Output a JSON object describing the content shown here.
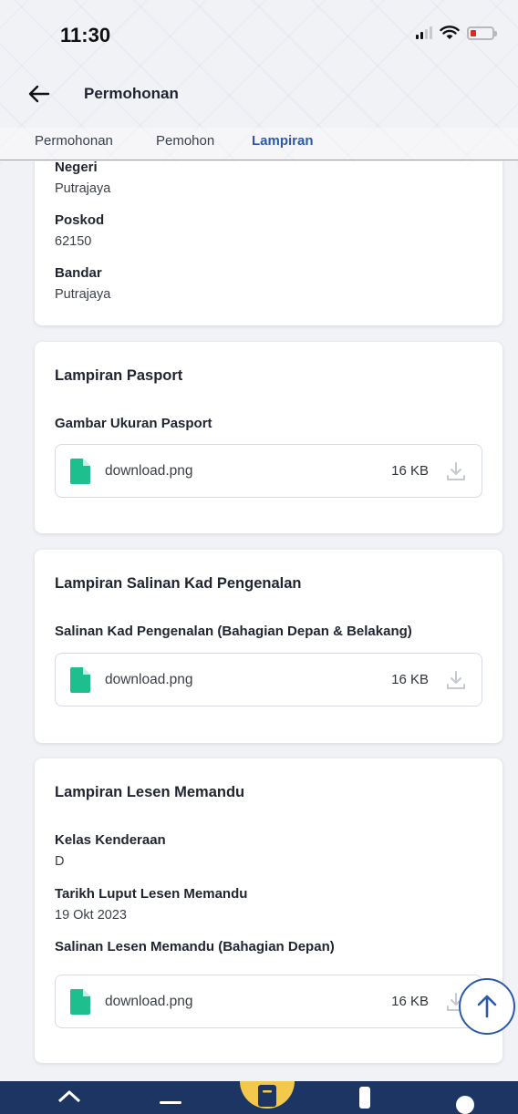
{
  "status_bar": {
    "time": "11:30"
  },
  "header": {
    "title": "Permohonan"
  },
  "tabs": [
    {
      "label": "Permohonan"
    },
    {
      "label": "Pemohon"
    },
    {
      "label": "Lampiran"
    }
  ],
  "address_card": {
    "fields": [
      {
        "label": "Negeri",
        "value": "Putrajaya"
      },
      {
        "label": "Poskod",
        "value": "62150"
      },
      {
        "label": "Bandar",
        "value": "Putrajaya"
      }
    ]
  },
  "passport_card": {
    "title": "Lampiran Pasport",
    "subtitle": "Gambar Ukuran Pasport",
    "file": {
      "name": "download.png",
      "size": "16 KB"
    }
  },
  "ic_card": {
    "title": "Lampiran Salinan Kad Pengenalan",
    "subtitle": "Salinan Kad Pengenalan (Bahagian Depan & Belakang)",
    "file": {
      "name": "download.png",
      "size": "16 KB"
    }
  },
  "license_card": {
    "title": "Lampiran Lesen Memandu",
    "fields": [
      {
        "label": "Kelas Kenderaan",
        "value": "D"
      },
      {
        "label": "Tarikh Luput Lesen Memandu",
        "value": "19 Okt 2023"
      }
    ],
    "subtitle": "Salinan Lesen Memandu (Bahagian Depan)",
    "file": {
      "name": "download.png",
      "size": "16 KB"
    }
  },
  "icons": {
    "file": "file-icon",
    "download": "download-icon",
    "back": "arrow-left-icon",
    "scroll_top": "arrow-up-icon"
  },
  "colors": {
    "accent": "#2c5aa8",
    "file_icon": "#1dbf8e",
    "nav_bg": "#1d3563",
    "nav_center": "#f2c94c"
  }
}
